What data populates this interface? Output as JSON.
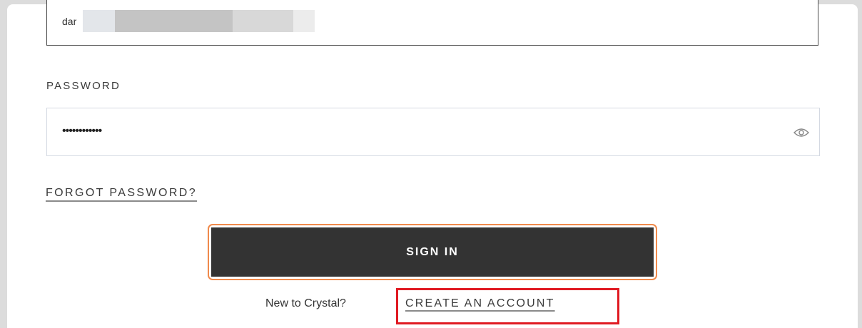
{
  "email": {
    "value": "dar"
  },
  "password": {
    "label": "PASSWORD",
    "value": "••••••••••••",
    "toggle_icon": "eye-icon"
  },
  "links": {
    "forgot_password": "FORGOT PASSWORD?",
    "create_account": "CREATE AN ACCOUNT"
  },
  "buttons": {
    "sign_in": "SIGN IN"
  },
  "signup_prompt": "New to Crystal?",
  "colors": {
    "button_bg": "#333333",
    "button_highlight": "#f08a4b",
    "annotation_box": "#e01a22"
  }
}
